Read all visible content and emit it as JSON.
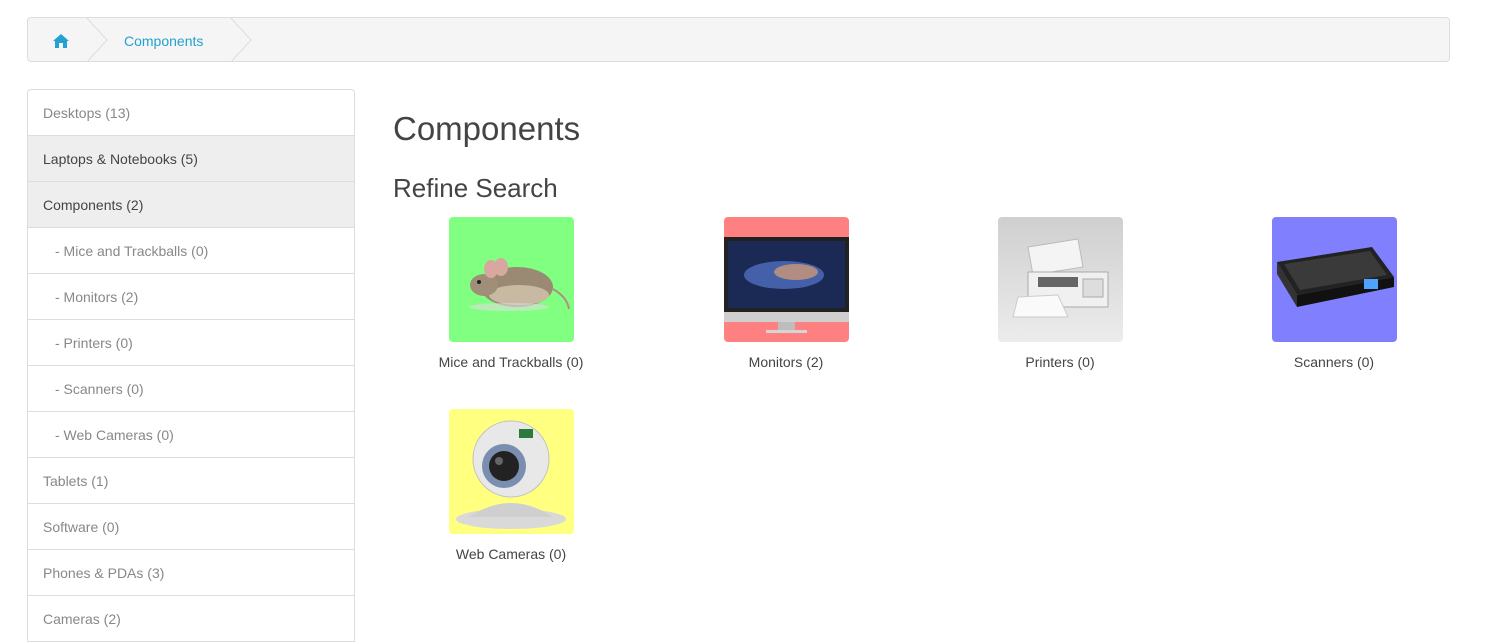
{
  "breadcrumb": {
    "home_icon": "home-icon",
    "current": "Components"
  },
  "sidebar": {
    "items": [
      {
        "label": "Desktops (13)"
      },
      {
        "label": "Laptops & Notebooks (5)"
      },
      {
        "label": "Components (2)"
      },
      {
        "label": "- Mice and Trackballs (0)"
      },
      {
        "label": "- Monitors (2)"
      },
      {
        "label": "- Printers (0)"
      },
      {
        "label": "- Scanners (0)"
      },
      {
        "label": "- Web Cameras (0)"
      },
      {
        "label": "Tablets (1)"
      },
      {
        "label": "Software (0)"
      },
      {
        "label": "Phones & PDAs (3)"
      },
      {
        "label": "Cameras (2)"
      }
    ]
  },
  "main": {
    "title": "Components",
    "refine_heading": "Refine Search",
    "categories": [
      {
        "label": "Mice and Trackballs (0)",
        "bg": "#80ff80"
      },
      {
        "label": "Monitors (2)",
        "bg": "#ff8080"
      },
      {
        "label": "Printers (0)",
        "bg": "#e6e6e6"
      },
      {
        "label": "Scanners (0)",
        "bg": "#8080ff"
      },
      {
        "label": "Web Cameras (0)",
        "bg": "#ffff80"
      }
    ]
  },
  "colors": {
    "link": "#23a1d1",
    "active_bg": "#eeeeee"
  }
}
